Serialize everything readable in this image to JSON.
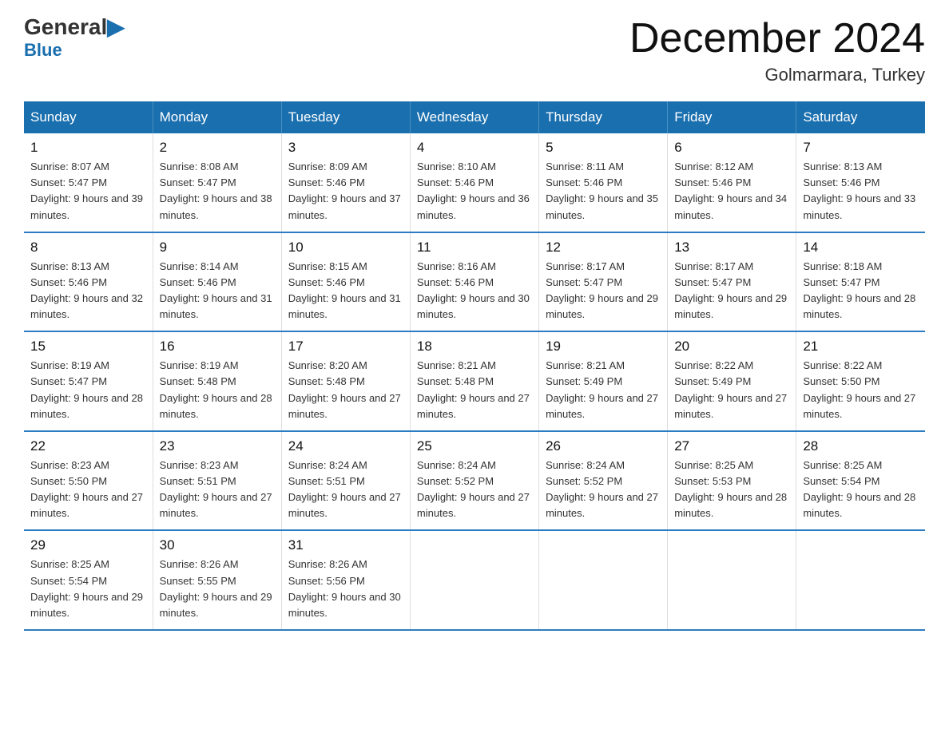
{
  "logo": {
    "general": "General",
    "blue": "Blue",
    "triangle": ""
  },
  "title": "December 2024",
  "subtitle": "Golmarmara, Turkey",
  "days_of_week": [
    "Sunday",
    "Monday",
    "Tuesday",
    "Wednesday",
    "Thursday",
    "Friday",
    "Saturday"
  ],
  "weeks": [
    [
      {
        "day": "1",
        "sunrise": "8:07 AM",
        "sunset": "5:47 PM",
        "daylight": "9 hours and 39 minutes."
      },
      {
        "day": "2",
        "sunrise": "8:08 AM",
        "sunset": "5:47 PM",
        "daylight": "9 hours and 38 minutes."
      },
      {
        "day": "3",
        "sunrise": "8:09 AM",
        "sunset": "5:46 PM",
        "daylight": "9 hours and 37 minutes."
      },
      {
        "day": "4",
        "sunrise": "8:10 AM",
        "sunset": "5:46 PM",
        "daylight": "9 hours and 36 minutes."
      },
      {
        "day": "5",
        "sunrise": "8:11 AM",
        "sunset": "5:46 PM",
        "daylight": "9 hours and 35 minutes."
      },
      {
        "day": "6",
        "sunrise": "8:12 AM",
        "sunset": "5:46 PM",
        "daylight": "9 hours and 34 minutes."
      },
      {
        "day": "7",
        "sunrise": "8:13 AM",
        "sunset": "5:46 PM",
        "daylight": "9 hours and 33 minutes."
      }
    ],
    [
      {
        "day": "8",
        "sunrise": "8:13 AM",
        "sunset": "5:46 PM",
        "daylight": "9 hours and 32 minutes."
      },
      {
        "day": "9",
        "sunrise": "8:14 AM",
        "sunset": "5:46 PM",
        "daylight": "9 hours and 31 minutes."
      },
      {
        "day": "10",
        "sunrise": "8:15 AM",
        "sunset": "5:46 PM",
        "daylight": "9 hours and 31 minutes."
      },
      {
        "day": "11",
        "sunrise": "8:16 AM",
        "sunset": "5:46 PM",
        "daylight": "9 hours and 30 minutes."
      },
      {
        "day": "12",
        "sunrise": "8:17 AM",
        "sunset": "5:47 PM",
        "daylight": "9 hours and 29 minutes."
      },
      {
        "day": "13",
        "sunrise": "8:17 AM",
        "sunset": "5:47 PM",
        "daylight": "9 hours and 29 minutes."
      },
      {
        "day": "14",
        "sunrise": "8:18 AM",
        "sunset": "5:47 PM",
        "daylight": "9 hours and 28 minutes."
      }
    ],
    [
      {
        "day": "15",
        "sunrise": "8:19 AM",
        "sunset": "5:47 PM",
        "daylight": "9 hours and 28 minutes."
      },
      {
        "day": "16",
        "sunrise": "8:19 AM",
        "sunset": "5:48 PM",
        "daylight": "9 hours and 28 minutes."
      },
      {
        "day": "17",
        "sunrise": "8:20 AM",
        "sunset": "5:48 PM",
        "daylight": "9 hours and 27 minutes."
      },
      {
        "day": "18",
        "sunrise": "8:21 AM",
        "sunset": "5:48 PM",
        "daylight": "9 hours and 27 minutes."
      },
      {
        "day": "19",
        "sunrise": "8:21 AM",
        "sunset": "5:49 PM",
        "daylight": "9 hours and 27 minutes."
      },
      {
        "day": "20",
        "sunrise": "8:22 AM",
        "sunset": "5:49 PM",
        "daylight": "9 hours and 27 minutes."
      },
      {
        "day": "21",
        "sunrise": "8:22 AM",
        "sunset": "5:50 PM",
        "daylight": "9 hours and 27 minutes."
      }
    ],
    [
      {
        "day": "22",
        "sunrise": "8:23 AM",
        "sunset": "5:50 PM",
        "daylight": "9 hours and 27 minutes."
      },
      {
        "day": "23",
        "sunrise": "8:23 AM",
        "sunset": "5:51 PM",
        "daylight": "9 hours and 27 minutes."
      },
      {
        "day": "24",
        "sunrise": "8:24 AM",
        "sunset": "5:51 PM",
        "daylight": "9 hours and 27 minutes."
      },
      {
        "day": "25",
        "sunrise": "8:24 AM",
        "sunset": "5:52 PM",
        "daylight": "9 hours and 27 minutes."
      },
      {
        "day": "26",
        "sunrise": "8:24 AM",
        "sunset": "5:52 PM",
        "daylight": "9 hours and 27 minutes."
      },
      {
        "day": "27",
        "sunrise": "8:25 AM",
        "sunset": "5:53 PM",
        "daylight": "9 hours and 28 minutes."
      },
      {
        "day": "28",
        "sunrise": "8:25 AM",
        "sunset": "5:54 PM",
        "daylight": "9 hours and 28 minutes."
      }
    ],
    [
      {
        "day": "29",
        "sunrise": "8:25 AM",
        "sunset": "5:54 PM",
        "daylight": "9 hours and 29 minutes."
      },
      {
        "day": "30",
        "sunrise": "8:26 AM",
        "sunset": "5:55 PM",
        "daylight": "9 hours and 29 minutes."
      },
      {
        "day": "31",
        "sunrise": "8:26 AM",
        "sunset": "5:56 PM",
        "daylight": "9 hours and 30 minutes."
      },
      null,
      null,
      null,
      null
    ]
  ]
}
